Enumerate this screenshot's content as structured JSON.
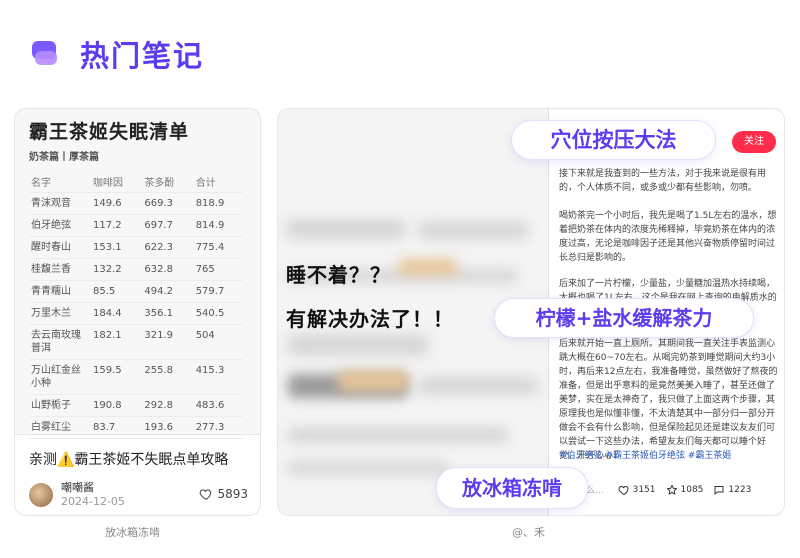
{
  "header": {
    "title": "热门笔记"
  },
  "left_card": {
    "doc": {
      "title": "霸王茶姬失眠清单",
      "subtitle": "奶茶篇丨厚茶篇",
      "columns": [
        "名字",
        "咖啡因",
        "茶多酚",
        "合计"
      ],
      "rows": [
        [
          "青沫观音",
          "149.6",
          "669.3",
          "818.9"
        ],
        [
          "伯牙绝弦",
          "117.2",
          "697.7",
          "814.9"
        ],
        [
          "醒时春山",
          "153.1",
          "622.3",
          "775.4"
        ],
        [
          "桂馥兰香",
          "132.2",
          "632.8",
          "765"
        ],
        [
          "青青糯山",
          "85.5",
          "494.2",
          "579.7"
        ],
        [
          "万里木兰",
          "184.4",
          "356.1",
          "540.5"
        ],
        [
          "去云南玫瑰普洱",
          "182.1",
          "321.9",
          "504"
        ],
        [
          "万山红金丝小种",
          "159.5",
          "255.8",
          "415.3"
        ],
        [
          "山野栀子",
          "190.8",
          "292.8",
          "483.6"
        ],
        [
          "白雾红尘",
          "83.7",
          "193.6",
          "277.3"
        ]
      ]
    },
    "caption": "亲测⚠️霸王茶姬不失眠点单攻略",
    "author": {
      "name": "嘲嘲酱",
      "date": "2024-12-05"
    },
    "likes": "5893",
    "footer": "放冰箱冻啃"
  },
  "right_card": {
    "overlay_text": {
      "line1": "睡不着？？",
      "line2": "有解决办法了！！"
    },
    "pills": {
      "top": "穴位按压大法",
      "middle": "柠檬+盐水缓解茶力",
      "bottom": "放冰箱冻啃"
    },
    "follow_label": "关注",
    "paragraphs": [
      "接下来就是我查到的一些方法，对于我来说是很有用的，个人体质不同，或多或少都有些影响，勿喷。",
      "喝奶茶完一个小时后，我先是喝了1.5L左右的温水，想着把奶茶在体内的浓度先稀释掉，毕竟奶茶在体内的浓度过高，无论是咖啡因子还是其他兴奋物质停留时间过长总归是影响的。",
      "后来加了一片柠檬，少量盐，少量糖加温热水持续喝，大概也喝了1L左右。这个是我在网上查询的电解质水的",
      "后来就开始一直上厕所。其期间我一直关注手表监测心跳大概在60~70左右。从喝完奶茶到睡觉期间大约3小时，再后来12点左右，我准备睡觉，虽然做好了熬夜的准备，但是出乎意料的是竟然美美入睡了，甚至还做了美梦，实在是太神奇了，我只做了上面这两个步骤，其原理我也是似懂非懂，不太清楚其中一部分归一部分开做会不会有什么影响，但是保险起见还是建议友友们可以尝试一下这些办法，希望友友们每天都可以睡个好觉，开开心心！"
    ],
    "tags": "#伯牙绝弦 #霸王茶姬伯牙绝弦 #霸王茶姬",
    "stats": {
      "comment_placeholder": "说点什么...",
      "likes": "3151",
      "stars": "1085",
      "comments": "1223"
    },
    "footer": "@、禾"
  }
}
